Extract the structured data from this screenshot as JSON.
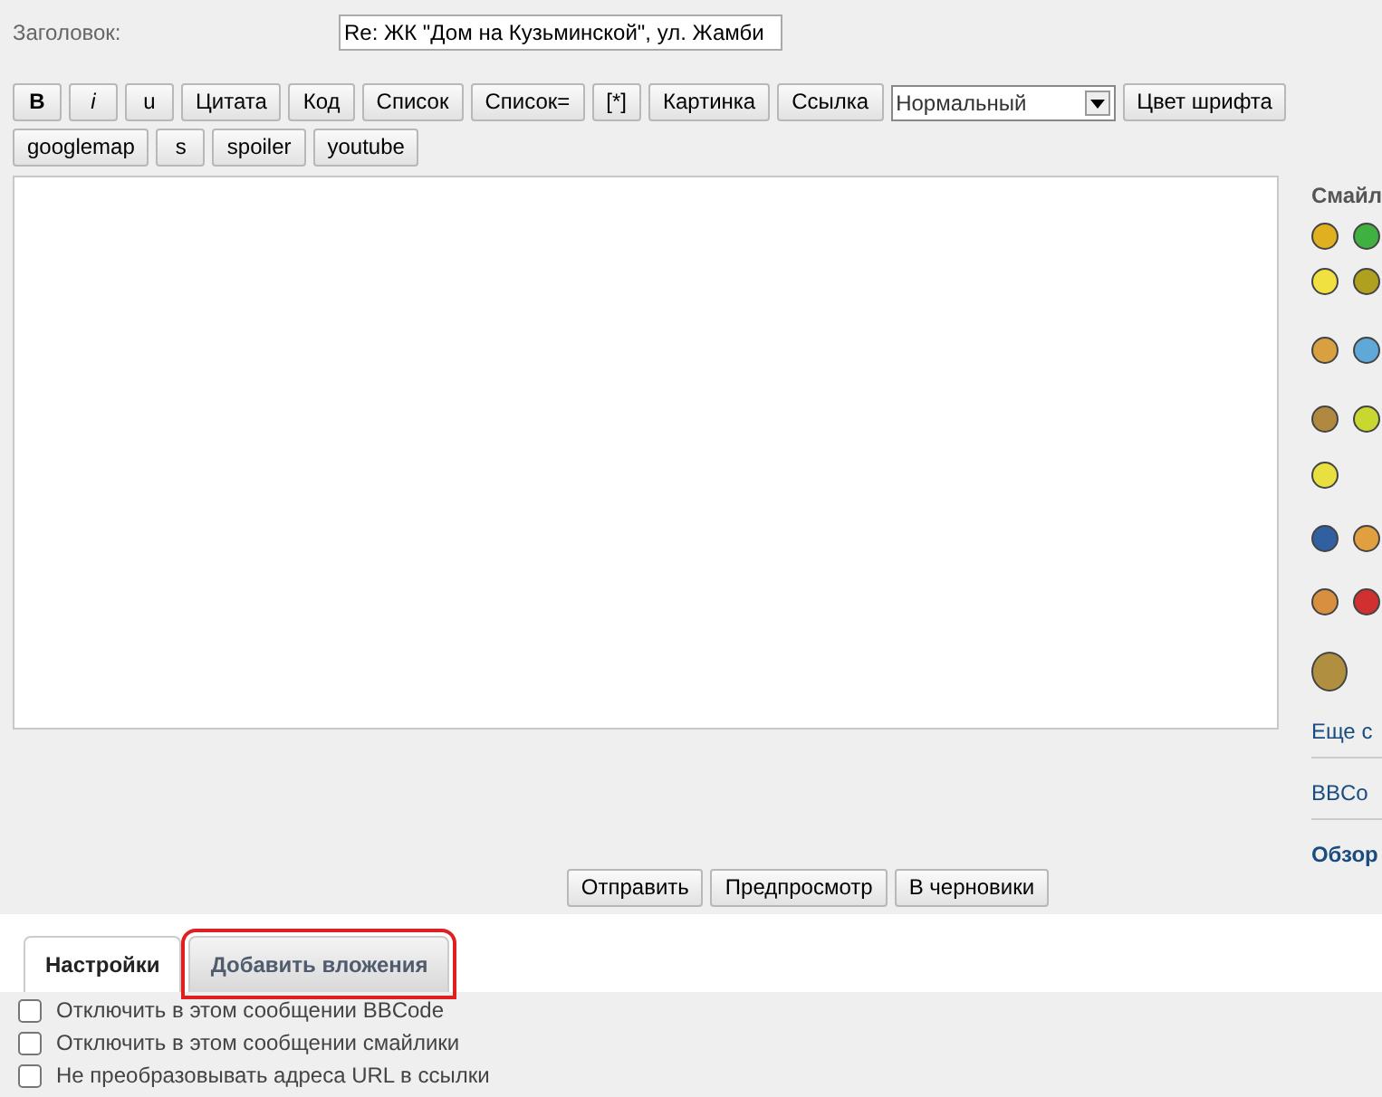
{
  "subject": {
    "label": "Заголовок:",
    "value": "Re: ЖК \"Дом на Кузьминской\", ул. Жамби"
  },
  "toolbar_row_1": [
    {
      "kind": "bold",
      "label": "B"
    },
    {
      "kind": "italic",
      "label": "i"
    },
    {
      "kind": "button",
      "label": "u"
    },
    {
      "kind": "button",
      "label": "Цитата"
    },
    {
      "kind": "button",
      "label": "Код"
    },
    {
      "kind": "button",
      "label": "Список"
    },
    {
      "kind": "button",
      "label": "Список="
    },
    {
      "kind": "button",
      "label": "[*]"
    },
    {
      "kind": "button",
      "label": "Картинка"
    },
    {
      "kind": "button",
      "label": "Ссылка"
    },
    {
      "kind": "select",
      "value": "Нормальный"
    },
    {
      "kind": "button",
      "label": "Цвет шрифта"
    }
  ],
  "toolbar_row_2": [
    {
      "kind": "button",
      "label": "googlemap"
    },
    {
      "kind": "button",
      "label": "s"
    },
    {
      "kind": "button",
      "label": "spoiler"
    },
    {
      "kind": "button",
      "label": "youtube"
    }
  ],
  "smilies_panel": {
    "title": "Смайл",
    "rows": [
      [
        {
          "color": "#e0b020"
        },
        {
          "color": "#40b040"
        }
      ],
      [
        {
          "color": "#f0e040"
        },
        {
          "color": "#b0a020"
        }
      ],
      [
        {
          "color": "#d8a040"
        },
        {
          "color": "#60a8d8"
        }
      ],
      [
        {
          "color": "#b08840"
        },
        {
          "color": "#c8d830"
        }
      ],
      [
        {
          "color": "#e8e040"
        }
      ],
      [
        {
          "color": "#3060a0"
        },
        {
          "color": "#e0a040"
        }
      ],
      [
        {
          "color": "#d89040"
        },
        {
          "color": "#d03030"
        }
      ],
      [
        {
          "color": "#b09040"
        }
      ]
    ],
    "links": [
      "Еще с",
      "BBCo",
      "Обзор"
    ]
  },
  "actions": [
    "Отправить",
    "Предпросмотр",
    "В черновики"
  ],
  "tabs": [
    {
      "label": "Настройки",
      "selected": true,
      "highlighted": false
    },
    {
      "label": "Добавить вложения",
      "selected": false,
      "highlighted": true
    }
  ],
  "options": [
    {
      "label": "Отключить в этом сообщении BBCode",
      "checked": false
    },
    {
      "label": "Отключить в этом сообщении смайлики",
      "checked": false
    },
    {
      "label": "Не преобразовывать адреса URL в ссылки",
      "checked": false
    }
  ]
}
